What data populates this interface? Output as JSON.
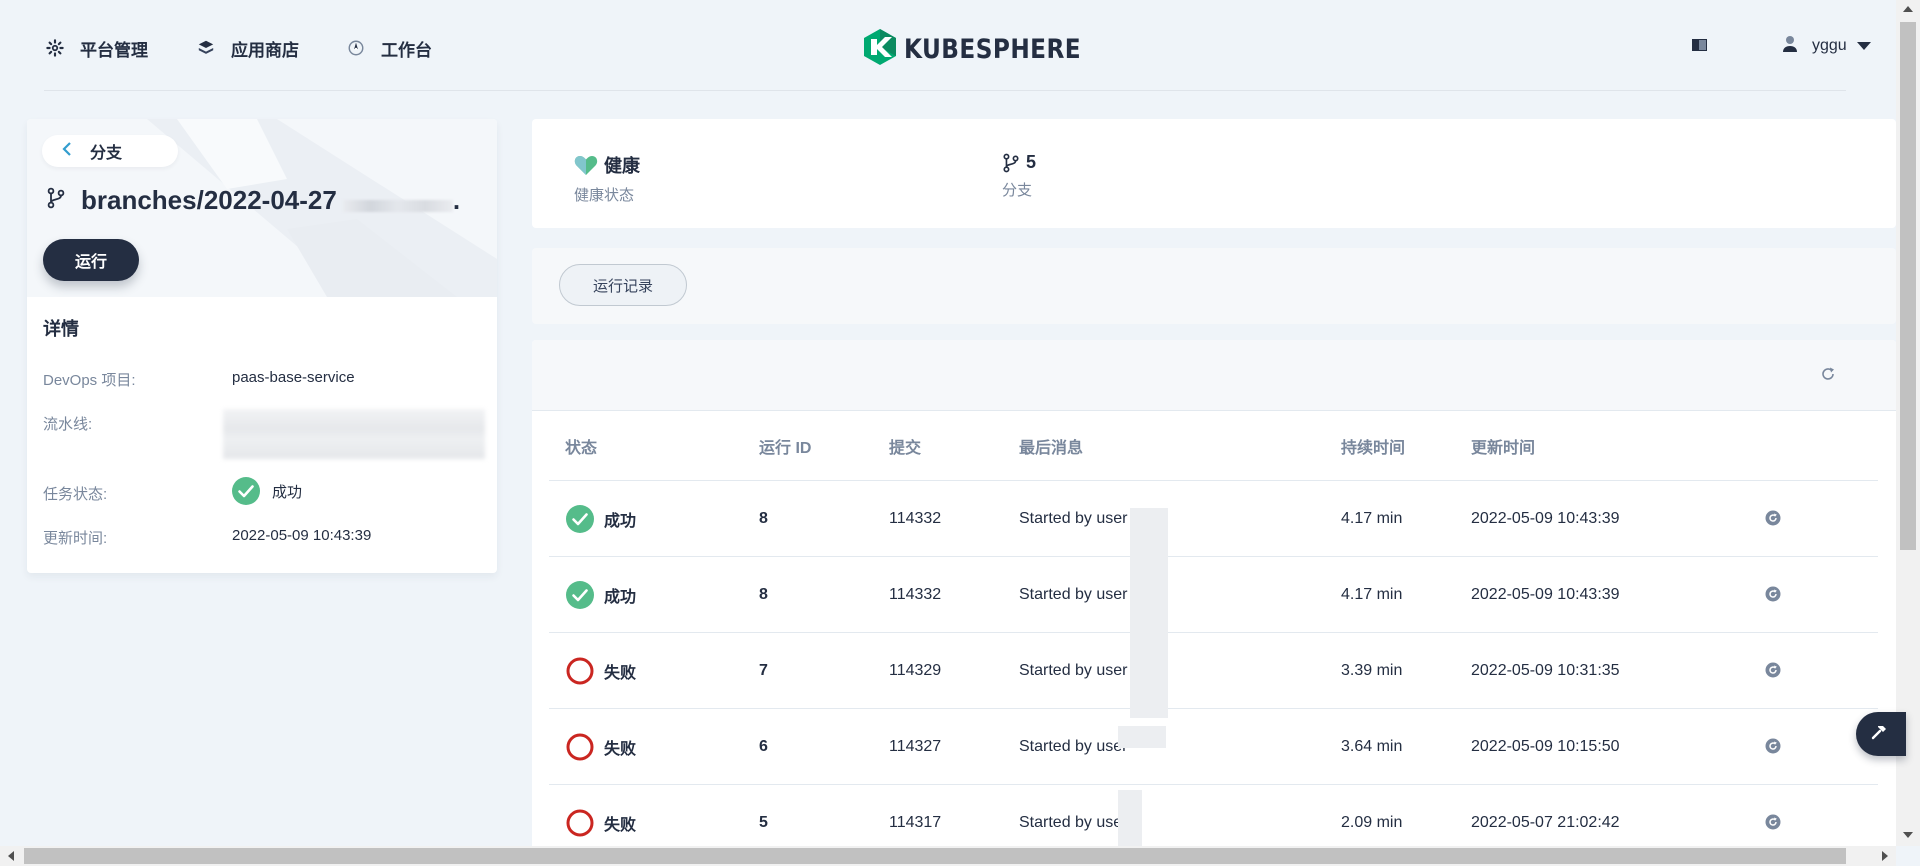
{
  "nav": {
    "platform_label": "平台管理",
    "appstore_label": "应用商店",
    "workbench_label": "工作台",
    "brand": "KUBESPHERE",
    "user": "yggu"
  },
  "branch_panel": {
    "back_label": "分支",
    "branch_name": "branches/2022-04-27",
    "branch_suffix": ".",
    "run_label": "运行",
    "details_title": "详情",
    "devops_label": "DevOps 项目:",
    "devops_value": "paas-base-service",
    "pipeline_label": "流水线:",
    "task_status_label": "任务状态:",
    "task_status_value": "成功",
    "updated_label": "更新时间:",
    "updated_value": "2022-05-09 10:43:39"
  },
  "summary": {
    "health_value": "健康",
    "health_label": "健康状态",
    "branch_count": "5",
    "branch_label": "分支"
  },
  "tabs": [
    "运行记录"
  ],
  "table": {
    "columns": [
      "状态",
      "运行 ID",
      "提交",
      "最后消息",
      "持续时间",
      "更新时间"
    ],
    "rows": [
      {
        "status": "成功",
        "id": "8",
        "commit": "114332",
        "message": "Started by user",
        "duration": "4.17 min",
        "updated": "2022-05-09 10:43:39"
      },
      {
        "status": "成功",
        "id": "8",
        "commit": "114332",
        "message": "Started by user",
        "duration": "4.17 min",
        "updated": "2022-05-09 10:43:39"
      },
      {
        "status": "失败",
        "id": "7",
        "commit": "114329",
        "message": "Started by user",
        "duration": "3.39 min",
        "updated": "2022-05-09 10:31:35"
      },
      {
        "status": "失败",
        "id": "6",
        "commit": "114327",
        "message": "Started by user",
        "duration": "3.64 min",
        "updated": "2022-05-09 10:15:50"
      },
      {
        "status": "失败",
        "id": "5",
        "commit": "114317",
        "message": "Started by user",
        "duration": "2.09 min",
        "updated": "2022-05-07 21:02:42"
      }
    ]
  },
  "colors": {
    "success": "#55bc8a",
    "failure": "#ca2621",
    "dark": "#242e42",
    "brand_green": "#00a971"
  },
  "icons": [
    "gear-icon",
    "stack-icon",
    "compass-icon",
    "book-icon",
    "user-icon",
    "caret-down-icon",
    "chevron-left-icon",
    "git-branch-icon",
    "check-circle-icon",
    "fail-circle-icon",
    "heart-icon",
    "refresh-icon",
    "replay-icon",
    "hammer-icon"
  ]
}
